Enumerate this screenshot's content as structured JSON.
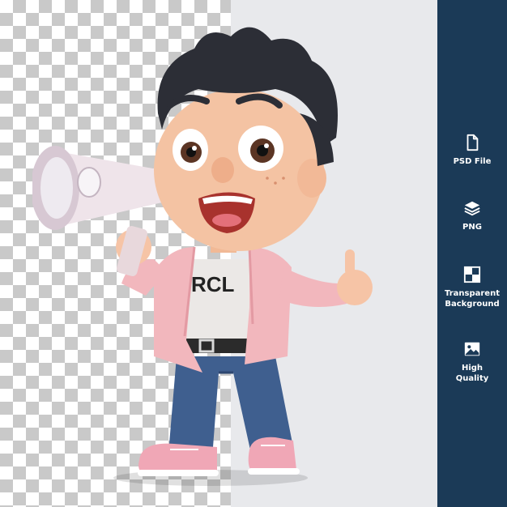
{
  "colors": {
    "sidebar_bg": "#1b3a57",
    "checker_dark": "#c9c9c9",
    "backdrop": "#e8e9ec"
  },
  "preview": {
    "subject": "3d-cartoon-boy-with-megaphone",
    "shirt_text": "RCL"
  },
  "sidebar": {
    "features": [
      {
        "icon": "file-icon",
        "label_line1": "PSD File",
        "label_line2": ""
      },
      {
        "icon": "layers-icon",
        "label_line1": "PNG",
        "label_line2": ""
      },
      {
        "icon": "transparency-grid-icon",
        "label_line1": "Transparent",
        "label_line2": "Background"
      },
      {
        "icon": "image-icon",
        "label_line1": "High",
        "label_line2": "Quality"
      }
    ]
  }
}
